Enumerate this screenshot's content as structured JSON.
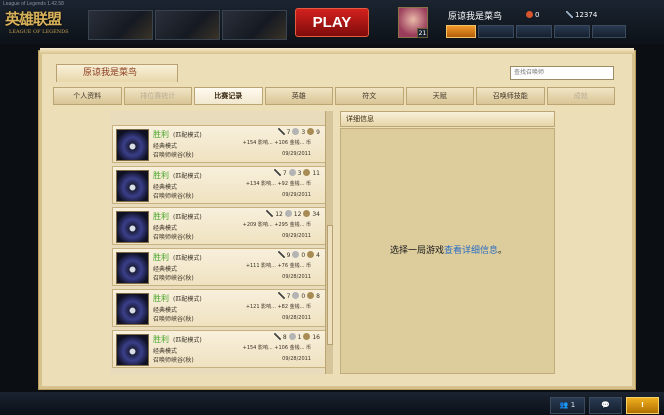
{
  "window_title": "League of Legends 1.42.58",
  "logo": {
    "zh": "英雄联盟",
    "en": "LEAGUE OF LEGENDS"
  },
  "play_label": "PLAY",
  "profile": {
    "name": "原谅我是菜鸟",
    "level": "21",
    "rp": "0",
    "ip": "12374"
  },
  "page_tab_title": "原谅我是菜鸟",
  "search_placeholder": "查找召唤师",
  "tabs": [
    "个人资料",
    "排位赛统计",
    "比赛记录",
    "英雄",
    "符文",
    "天赋",
    "召唤师技能",
    "成就"
  ],
  "active_tab": "比赛记录",
  "matches": [
    {
      "result": "胜利",
      "mode": "(匹配模式)",
      "type": "经典模式",
      "map": "召唤师峡谷(秋)",
      "k": "7",
      "d": "3",
      "a": "9",
      "ip_reward": "+154 影响... +106 金钱... 币",
      "date": "09/29/2011"
    },
    {
      "result": "胜利",
      "mode": "(匹配模式)",
      "type": "经典模式",
      "map": "召唤师峡谷(秋)",
      "k": "7",
      "d": "3",
      "a": "11",
      "ip_reward": "+134 影响... +92 金钱... 币",
      "date": "09/29/2011"
    },
    {
      "result": "胜利",
      "mode": "(匹配模式)",
      "type": "经典模式",
      "map": "召唤师峡谷(秋)",
      "k": "12",
      "d": "12",
      "a": "34",
      "ip_reward": "+209 影响... +295 金钱... 币",
      "date": "09/29/2011"
    },
    {
      "result": "胜利",
      "mode": "(匹配模式)",
      "type": "经典模式",
      "map": "召唤师峡谷(秋)",
      "k": "9",
      "d": "0",
      "a": "4",
      "ip_reward": "+111 影响... +76 金钱... 币",
      "date": "09/28/2011"
    },
    {
      "result": "胜利",
      "mode": "(匹配模式)",
      "type": "经典模式",
      "map": "召唤师峡谷(秋)",
      "k": "7",
      "d": "0",
      "a": "8",
      "ip_reward": "+121 影响... +82 金钱... 币",
      "date": "09/28/2011"
    },
    {
      "result": "胜利",
      "mode": "(匹配模式)",
      "type": "经典模式",
      "map": "召唤师峡谷(秋)",
      "k": "8",
      "d": "1",
      "a": "16",
      "ip_reward": "+154 影响... +106 金钱... 币",
      "date": "09/28/2011"
    }
  ],
  "detail": {
    "header": "详细信息",
    "prompt": "选择一局游戏",
    "link": "查看详细信息",
    "suffix": "。"
  },
  "bottom": {
    "friends_count": "1",
    "alert_label": "!"
  },
  "colors": {
    "win": "#49a52a",
    "link": "#2b6fc2",
    "play": "#d3211e",
    "accent": "#8a3a1c"
  }
}
